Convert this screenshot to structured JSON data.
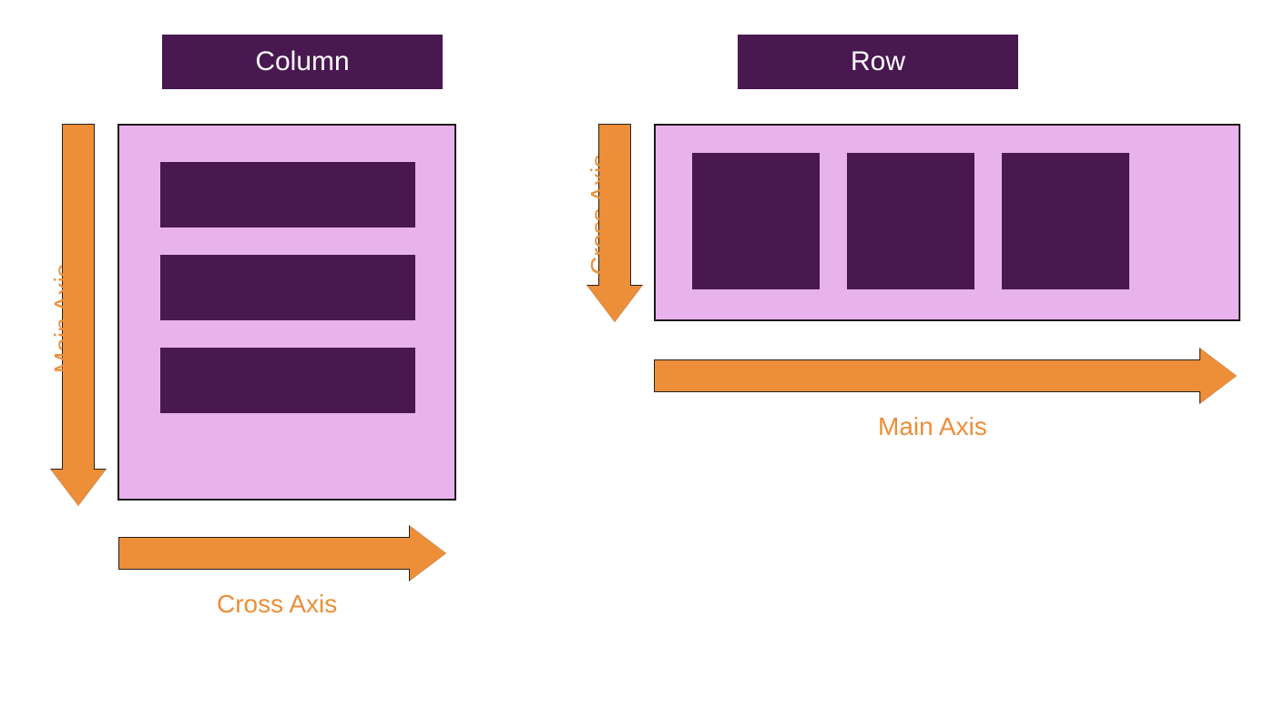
{
  "colors": {
    "dark_purple": "#491851",
    "light_purple": "#e8b3ec",
    "orange": "#ed8e38",
    "border": "#1a1a1a"
  },
  "column_section": {
    "title": "Column",
    "main_axis_label": "Main Axis",
    "cross_axis_label": "Cross Axis",
    "main_axis_direction": "vertical",
    "cross_axis_direction": "horizontal",
    "item_count": 3
  },
  "row_section": {
    "title": "Row",
    "main_axis_label": "Main Axis",
    "cross_axis_label": "Cross Axis",
    "main_axis_direction": "horizontal",
    "cross_axis_direction": "vertical",
    "item_count": 3
  }
}
